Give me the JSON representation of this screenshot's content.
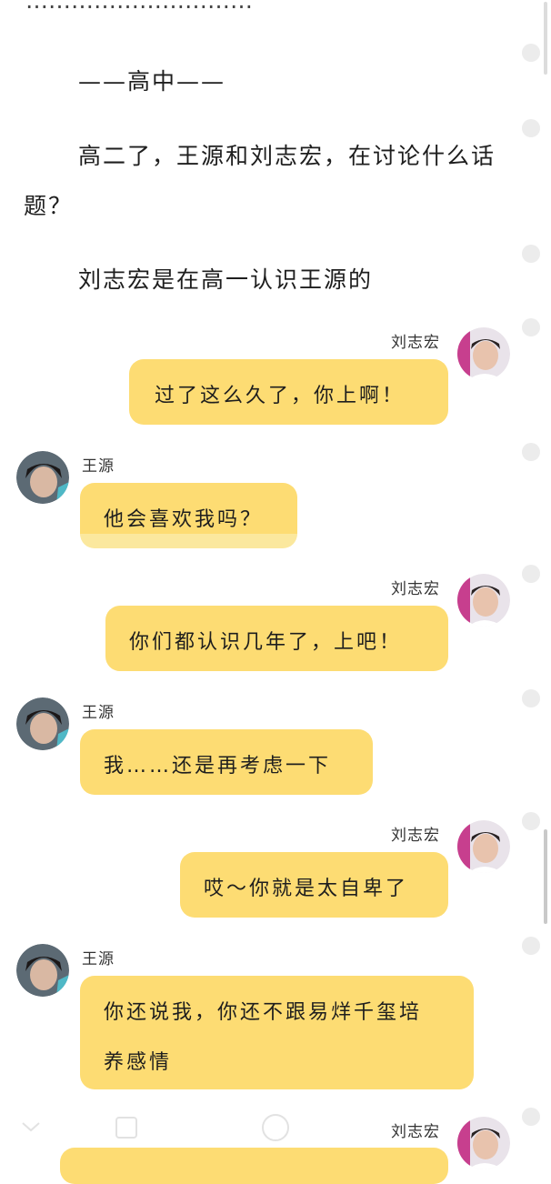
{
  "story": {
    "top_fragment": "…………………………",
    "section_header": "——高中——",
    "line1_a": "高二了，王源和刘志宏，在讨论什么话",
    "line1_b": "题？",
    "line2": "刘志宏是在高一认识王源的"
  },
  "messages": [
    {
      "speaker": "刘志宏",
      "side": "right",
      "text": "过了这么久了，你上啊！"
    },
    {
      "speaker": "王源",
      "side": "left",
      "text": "他会喜欢我吗？"
    },
    {
      "speaker": "刘志宏",
      "side": "right",
      "text": "你们都认识几年了，上吧！"
    },
    {
      "speaker": "王源",
      "side": "left",
      "text": "我……还是再考虑一下"
    },
    {
      "speaker": "刘志宏",
      "side": "right",
      "text": "哎～你就是太自卑了"
    },
    {
      "speaker": "王源",
      "side": "left",
      "text_a": "你还说我，你还不跟易烊千玺培",
      "text_b": "养感情"
    },
    {
      "speaker": "刘志宏",
      "side": "right",
      "text": ""
    }
  ],
  "nav": {
    "back_icon": "chevron-down-icon",
    "recents_icon": "square-icon",
    "home_icon": "circle-icon"
  },
  "colors": {
    "bubble": "#fddc73",
    "background": "#ffffff"
  }
}
